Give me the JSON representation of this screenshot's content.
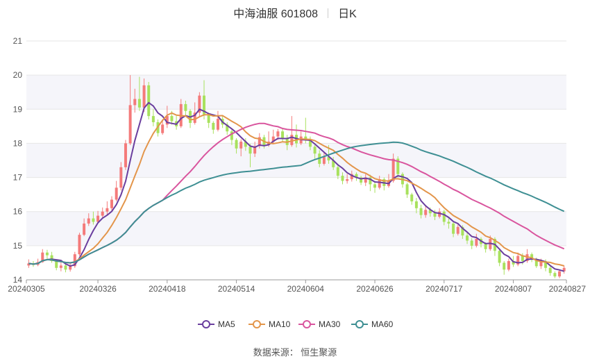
{
  "header": {
    "stock_name": "中海油服",
    "stock_code": "601808",
    "period": "日K"
  },
  "source_text": "数据来源： 恒生聚源",
  "chart_data": {
    "type": "candlestick",
    "ylim": [
      14,
      21
    ],
    "yticks": [
      "14",
      "15",
      "16",
      "17",
      "18",
      "19",
      "20",
      "21"
    ],
    "x_tick_labels": [
      "20240305",
      "20240326",
      "20240418",
      "20240514",
      "20240604",
      "20240626",
      "20240717",
      "20240807",
      "20240827"
    ],
    "x_tick_index": [
      0,
      15,
      30,
      45,
      60,
      75,
      90,
      105,
      119
    ],
    "colors": {
      "up": "#f47a7a",
      "down": "#a8e15d",
      "grid": "#e6e6e6",
      "band": "#f5f5fa"
    },
    "legend": [
      {
        "name": "MA5",
        "color": "#6a3e9e"
      },
      {
        "name": "MA10",
        "color": "#e3954a"
      },
      {
        "name": "MA30",
        "color": "#d9559e"
      },
      {
        "name": "MA60",
        "color": "#3e8f93"
      }
    ],
    "candles": [
      [
        14.42,
        14.48,
        14.6,
        14.35
      ],
      [
        14.48,
        14.44,
        14.55,
        14.38
      ],
      [
        14.44,
        14.52,
        14.62,
        14.4
      ],
      [
        14.52,
        14.8,
        14.9,
        14.5
      ],
      [
        14.8,
        14.72,
        14.88,
        14.62
      ],
      [
        14.72,
        14.55,
        14.82,
        14.5
      ],
      [
        14.55,
        14.35,
        14.6,
        14.28
      ],
      [
        14.35,
        14.42,
        14.5,
        14.25
      ],
      [
        14.42,
        14.3,
        14.48,
        14.22
      ],
      [
        14.3,
        14.4,
        14.48,
        14.24
      ],
      [
        14.4,
        14.75,
        14.82,
        14.35
      ],
      [
        14.75,
        15.32,
        15.38,
        14.7
      ],
      [
        15.32,
        15.65,
        15.8,
        15.28
      ],
      [
        15.65,
        15.8,
        15.95,
        15.58
      ],
      [
        15.8,
        15.7,
        16.0,
        15.62
      ],
      [
        15.7,
        15.88,
        16.02,
        15.66
      ],
      [
        15.88,
        16.0,
        16.12,
        15.8
      ],
      [
        16.0,
        16.1,
        16.3,
        15.92
      ],
      [
        16.1,
        16.35,
        16.45,
        16.02
      ],
      [
        16.35,
        16.7,
        16.9,
        16.3
      ],
      [
        16.7,
        17.3,
        17.45,
        16.62
      ],
      [
        17.3,
        18.0,
        18.1,
        17.22
      ],
      [
        18.0,
        19.12,
        20.0,
        17.95
      ],
      [
        19.12,
        19.3,
        19.6,
        18.9
      ],
      [
        19.3,
        19.05,
        19.95,
        18.95
      ],
      [
        19.05,
        19.7,
        19.9,
        18.92
      ],
      [
        19.7,
        18.8,
        19.8,
        18.7
      ],
      [
        18.8,
        18.62,
        19.0,
        18.5
      ],
      [
        18.62,
        18.3,
        18.7,
        18.2
      ],
      [
        18.3,
        18.55,
        18.7,
        18.25
      ],
      [
        18.55,
        18.8,
        19.1,
        18.45
      ],
      [
        18.8,
        18.65,
        18.95,
        18.55
      ],
      [
        18.65,
        18.5,
        18.8,
        18.4
      ],
      [
        18.5,
        19.15,
        19.3,
        18.45
      ],
      [
        19.15,
        18.95,
        19.25,
        18.8
      ],
      [
        18.95,
        18.6,
        19.0,
        18.45
      ],
      [
        18.6,
        18.9,
        19.2,
        18.55
      ],
      [
        18.9,
        19.4,
        19.5,
        18.8
      ],
      [
        19.4,
        18.85,
        19.85,
        18.7
      ],
      [
        18.85,
        18.6,
        18.9,
        18.45
      ],
      [
        18.6,
        18.4,
        18.65,
        18.28
      ],
      [
        18.4,
        18.72,
        18.95,
        18.35
      ],
      [
        18.72,
        18.55,
        18.8,
        18.45
      ],
      [
        18.55,
        18.35,
        18.62,
        18.25
      ],
      [
        18.35,
        18.1,
        18.4,
        17.95
      ],
      [
        18.1,
        17.85,
        18.15,
        17.7
      ],
      [
        17.85,
        18.05,
        18.12,
        17.62
      ],
      [
        18.05,
        17.9,
        18.15,
        17.78
      ],
      [
        17.9,
        17.7,
        17.98,
        17.3
      ],
      [
        17.7,
        17.92,
        18.05,
        17.6
      ],
      [
        17.92,
        18.18,
        18.3,
        17.85
      ],
      [
        18.18,
        17.95,
        18.25,
        17.85
      ],
      [
        17.95,
        18.05,
        18.35,
        17.9
      ],
      [
        18.05,
        18.2,
        18.4,
        17.98
      ],
      [
        18.2,
        18.35,
        18.42,
        18.1
      ],
      [
        18.35,
        18.15,
        18.45,
        18.05
      ],
      [
        18.15,
        17.95,
        18.25,
        17.8
      ],
      [
        17.95,
        18.25,
        18.8,
        17.9
      ],
      [
        18.25,
        18.0,
        18.55,
        17.88
      ],
      [
        18.0,
        18.2,
        18.35,
        17.95
      ],
      [
        18.2,
        18.1,
        18.75,
        18.0
      ],
      [
        18.1,
        17.9,
        18.2,
        17.8
      ],
      [
        17.9,
        17.7,
        17.95,
        17.55
      ],
      [
        17.7,
        17.4,
        17.8,
        17.3
      ],
      [
        17.4,
        17.6,
        17.75,
        17.35
      ],
      [
        17.6,
        17.5,
        17.95,
        17.4
      ],
      [
        17.5,
        17.3,
        17.6,
        17.22
      ],
      [
        17.3,
        17.05,
        17.4,
        16.95
      ],
      [
        17.05,
        16.9,
        17.15,
        16.8
      ],
      [
        16.9,
        16.95,
        17.1,
        16.82
      ],
      [
        16.95,
        17.1,
        17.2,
        16.88
      ],
      [
        17.1,
        17.0,
        17.15,
        16.9
      ],
      [
        17.0,
        16.85,
        17.05,
        16.78
      ],
      [
        16.85,
        17.0,
        17.1,
        16.75
      ],
      [
        17.0,
        16.8,
        17.08,
        16.6
      ],
      [
        16.8,
        16.7,
        16.9,
        16.55
      ],
      [
        16.7,
        16.95,
        17.05,
        16.65
      ],
      [
        16.95,
        16.75,
        17.0,
        16.62
      ],
      [
        16.75,
        16.9,
        17.1,
        16.7
      ],
      [
        16.9,
        17.55,
        17.7,
        16.85
      ],
      [
        17.55,
        17.1,
        17.62,
        17.0
      ],
      [
        17.1,
        16.8,
        17.15,
        16.7
      ],
      [
        16.8,
        16.5,
        16.85,
        16.4
      ],
      [
        16.5,
        16.3,
        16.55,
        16.2
      ],
      [
        16.3,
        16.1,
        16.4,
        15.95
      ],
      [
        16.1,
        15.9,
        16.2,
        15.8
      ],
      [
        15.9,
        16.05,
        16.15,
        15.82
      ],
      [
        16.05,
        15.95,
        16.12,
        15.85
      ],
      [
        15.95,
        15.85,
        16.05,
        15.75
      ],
      [
        15.85,
        16.0,
        16.1,
        15.8
      ],
      [
        16.0,
        15.7,
        16.05,
        15.6
      ],
      [
        15.7,
        15.65,
        15.8,
        15.5
      ],
      [
        15.65,
        15.35,
        15.72,
        15.25
      ],
      [
        15.35,
        15.55,
        15.62,
        15.3
      ],
      [
        15.55,
        15.3,
        15.6,
        15.2
      ],
      [
        15.3,
        15.15,
        15.38,
        15.05
      ],
      [
        15.15,
        15.0,
        15.22,
        14.9
      ],
      [
        15.0,
        15.2,
        15.35,
        14.95
      ],
      [
        15.2,
        15.05,
        15.25,
        14.95
      ],
      [
        15.05,
        14.9,
        15.1,
        14.8
      ],
      [
        14.9,
        15.2,
        15.3,
        14.85
      ],
      [
        15.2,
        14.85,
        15.25,
        14.7
      ],
      [
        14.85,
        14.5,
        14.9,
        14.4
      ],
      [
        14.5,
        14.3,
        14.55,
        14.15
      ],
      [
        14.3,
        14.55,
        14.62,
        14.25
      ],
      [
        14.55,
        14.45,
        14.7,
        14.38
      ],
      [
        14.45,
        14.7,
        14.8,
        14.4
      ],
      [
        14.7,
        14.55,
        14.78,
        14.45
      ],
      [
        14.55,
        14.75,
        14.9,
        14.5
      ],
      [
        14.75,
        14.6,
        14.8,
        14.52
      ],
      [
        14.6,
        14.4,
        14.65,
        14.35
      ],
      [
        14.4,
        14.55,
        14.62,
        14.32
      ],
      [
        14.55,
        14.35,
        14.6,
        14.25
      ],
      [
        14.35,
        14.2,
        14.4,
        14.12
      ],
      [
        14.2,
        14.1,
        14.25,
        14.05
      ],
      [
        14.1,
        14.25,
        14.3,
        14.05
      ],
      [
        14.25,
        14.35,
        14.42,
        14.18
      ]
    ]
  }
}
